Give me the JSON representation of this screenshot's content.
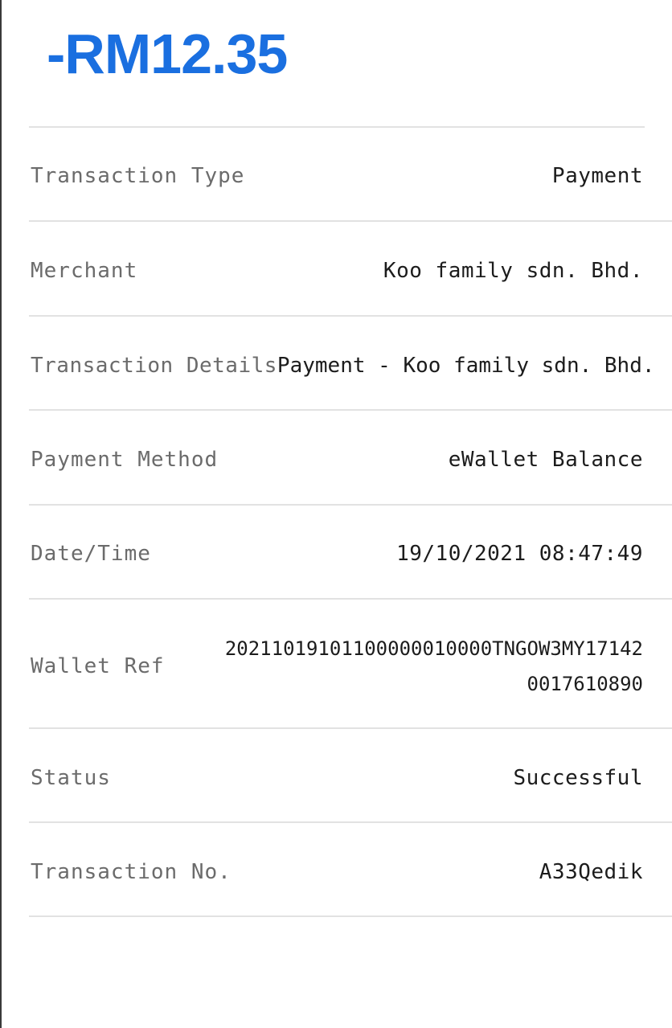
{
  "amount": "-RM12.35",
  "details": [
    {
      "label": "Transaction Type",
      "value": "Payment"
    },
    {
      "label": "Merchant",
      "value": "Koo family sdn. Bhd."
    },
    {
      "label": "Transaction Details",
      "value": "Payment - Koo family sdn. Bhd."
    },
    {
      "label": "Payment Method",
      "value": "eWallet Balance"
    },
    {
      "label": "Date/Time",
      "value": "19/10/2021 08:47:49"
    },
    {
      "label": "Wallet Ref",
      "value_line1": "20211019101100000010000TNGOW3MY17142",
      "value_line2": "0017610890"
    },
    {
      "label": "Status",
      "value": "Successful"
    },
    {
      "label": "Transaction No.",
      "value": "A33Qedik"
    }
  ]
}
